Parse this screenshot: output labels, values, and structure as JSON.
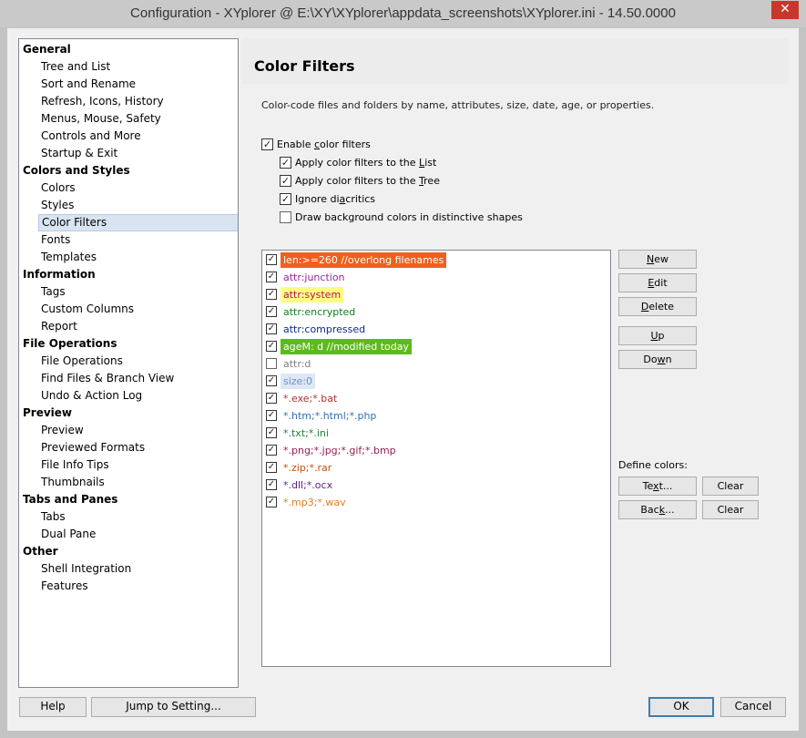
{
  "window": {
    "title": "Configuration - XYplorer @ E:\\XY\\XYplorer\\appdata_screenshots\\XYplorer.ini - 14.50.0000",
    "close_glyph": "✕"
  },
  "tree": {
    "items": [
      {
        "label": "General",
        "type": "group"
      },
      {
        "label": "Tree and List",
        "type": "child"
      },
      {
        "label": "Sort and Rename",
        "type": "child"
      },
      {
        "label": "Refresh, Icons, History",
        "type": "child"
      },
      {
        "label": "Menus, Mouse, Safety",
        "type": "child"
      },
      {
        "label": "Controls and More",
        "type": "child"
      },
      {
        "label": "Startup & Exit",
        "type": "child"
      },
      {
        "label": "Colors and Styles",
        "type": "group"
      },
      {
        "label": "Colors",
        "type": "child"
      },
      {
        "label": "Styles",
        "type": "child"
      },
      {
        "label": "Color Filters",
        "type": "child",
        "selected": true
      },
      {
        "label": "Fonts",
        "type": "child"
      },
      {
        "label": "Templates",
        "type": "child"
      },
      {
        "label": "Information",
        "type": "group"
      },
      {
        "label": "Tags",
        "type": "child"
      },
      {
        "label": "Custom Columns",
        "type": "child"
      },
      {
        "label": "Report",
        "type": "child"
      },
      {
        "label": "File Operations",
        "type": "group"
      },
      {
        "label": "File Operations",
        "type": "child"
      },
      {
        "label": "Find Files & Branch View",
        "type": "child"
      },
      {
        "label": "Undo & Action Log",
        "type": "child"
      },
      {
        "label": "Preview",
        "type": "group"
      },
      {
        "label": "Preview",
        "type": "child"
      },
      {
        "label": "Previewed Formats",
        "type": "child"
      },
      {
        "label": "File Info Tips",
        "type": "child"
      },
      {
        "label": "Thumbnails",
        "type": "child"
      },
      {
        "label": "Tabs and Panes",
        "type": "group"
      },
      {
        "label": "Tabs",
        "type": "child"
      },
      {
        "label": "Dual Pane",
        "type": "child"
      },
      {
        "label": "Other",
        "type": "group"
      },
      {
        "label": "Shell Integration",
        "type": "child"
      },
      {
        "label": "Features",
        "type": "child"
      }
    ]
  },
  "panel": {
    "title": "Color Filters",
    "description": "Color-code files and folders by name, attributes, size, date, age, or properties.",
    "options": {
      "enable": {
        "pre": "Enable ",
        "u": "c",
        "post": "olor filters",
        "checked": true
      },
      "list": {
        "pre": "Apply color filters to the ",
        "u": "L",
        "post": "ist",
        "checked": true
      },
      "tree": {
        "pre": "Apply color filters to the ",
        "u": "T",
        "post": "ree",
        "checked": true
      },
      "diacritics": {
        "pre": "Ignore di",
        "u": "a",
        "post": "critics",
        "checked": true
      },
      "shapes": {
        "pre": "Draw background colors in distinctive shapes",
        "u": "",
        "post": "",
        "checked": false
      }
    },
    "filters": [
      {
        "text": "len:>=260 //overlong filenames",
        "checked": true,
        "fg": "#ffffff",
        "bg": "#f0601c"
      },
      {
        "text": "attr:junction",
        "checked": true,
        "fg": "#a020a0",
        "bg": ""
      },
      {
        "text": "attr:system",
        "checked": true,
        "fg": "#b01060",
        "bg": "#ffff80"
      },
      {
        "text": "attr:encrypted",
        "checked": true,
        "fg": "#108020",
        "bg": ""
      },
      {
        "text": "attr:compressed",
        "checked": true,
        "fg": "#0a2a8a",
        "bg": ""
      },
      {
        "text": "ageM: d //modified today",
        "checked": true,
        "fg": "#ffffff",
        "bg": "#5cbb1c"
      },
      {
        "text": "attr:d",
        "checked": false,
        "fg": "#808080",
        "bg": ""
      },
      {
        "text": "size:0",
        "checked": true,
        "fg": "#7090c0",
        "bg": "#dde8f7"
      },
      {
        "text": "*.exe;*.bat",
        "checked": true,
        "fg": "#b03030",
        "bg": ""
      },
      {
        "text": "*.htm;*.html;*.php",
        "checked": true,
        "fg": "#3070b0",
        "bg": ""
      },
      {
        "text": "*.txt;*.ini",
        "checked": true,
        "fg": "#208040",
        "bg": ""
      },
      {
        "text": "*.png;*.jpg;*.gif;*.bmp",
        "checked": true,
        "fg": "#902050",
        "bg": ""
      },
      {
        "text": "*.zip;*.rar",
        "checked": true,
        "fg": "#c05010",
        "bg": ""
      },
      {
        "text": "*.dll;*.ocx",
        "checked": true,
        "fg": "#602080",
        "bg": ""
      },
      {
        "text": "*.mp3;*.wav",
        "checked": true,
        "fg": "#e08020",
        "bg": ""
      }
    ],
    "buttons": {
      "new": {
        "u": "N",
        "post": "ew"
      },
      "edit": {
        "u": "E",
        "post": "dit"
      },
      "delete": {
        "u": "D",
        "post": "elete"
      },
      "up": {
        "u": "U",
        "post": "p"
      },
      "down": {
        "pre": "Do",
        "u": "w",
        "post": "n"
      }
    },
    "define_colors_label": "Define colors:",
    "text_button": {
      "pre": "Te",
      "u": "x",
      "post": "t..."
    },
    "back_button": {
      "pre": "Bac",
      "u": "k",
      "post": "..."
    },
    "clear_label": "Clear"
  },
  "footer": {
    "help": "Help",
    "jump": "Jump to Setting...",
    "ok": "OK",
    "cancel": "Cancel"
  },
  "check_glyph": "✓"
}
